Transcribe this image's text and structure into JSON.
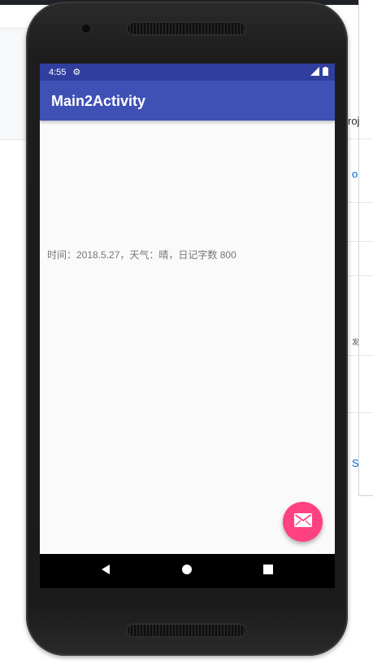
{
  "background": {
    "fragments": {
      "roj": "roj",
      "o": "o",
      "dot": "·",
      "garbled": "发",
      "s": "S"
    }
  },
  "status_bar": {
    "time": "4:55",
    "settings_icon": "gear-icon",
    "signal_icon": "signal-icon",
    "battery_icon": "battery-icon"
  },
  "app_bar": {
    "title": "Main2Activity"
  },
  "content": {
    "text": "时间：2018.5.27，天气：晴，日记字数 800"
  },
  "fab": {
    "icon": "email-icon",
    "color": "#ff4081"
  },
  "nav_bar": {
    "back_icon": "back-triangle-icon",
    "home_icon": "home-circle-icon",
    "recents_icon": "recents-square-icon"
  },
  "colors": {
    "primary": "#3f51b5",
    "primary_dark": "#303f9f",
    "accent": "#ff4081"
  }
}
